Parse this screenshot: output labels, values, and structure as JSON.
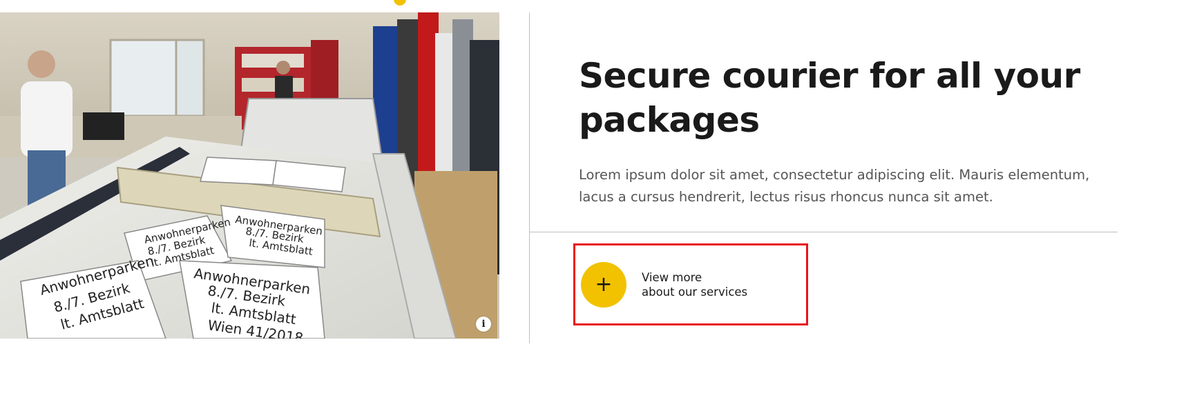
{
  "colors": {
    "accent": "#f2c200",
    "highlight": "#e8141e",
    "heading": "#1a1a1a",
    "body": "#555555",
    "divider": "#bfbfbf"
  },
  "image": {
    "alt": "Print workshop with sign-cutting plotter and vinyl rolls",
    "info_icon": "info-icon",
    "sign_text": [
      "Anwohnerparken",
      "8./7. Bezirk",
      "lt. Amtsblatt",
      "Wien 41/2018"
    ]
  },
  "main": {
    "heading": "Secure courier for all your packages",
    "body": "Lorem ipsum dolor sit amet, consectetur adipiscing elit. Mauris elementum, lacus a cursus hendrerit, lectus risus rhoncus nunca sit amet."
  },
  "cta": {
    "icon": "plus-icon",
    "line1": "View more",
    "line2": "about our services"
  }
}
